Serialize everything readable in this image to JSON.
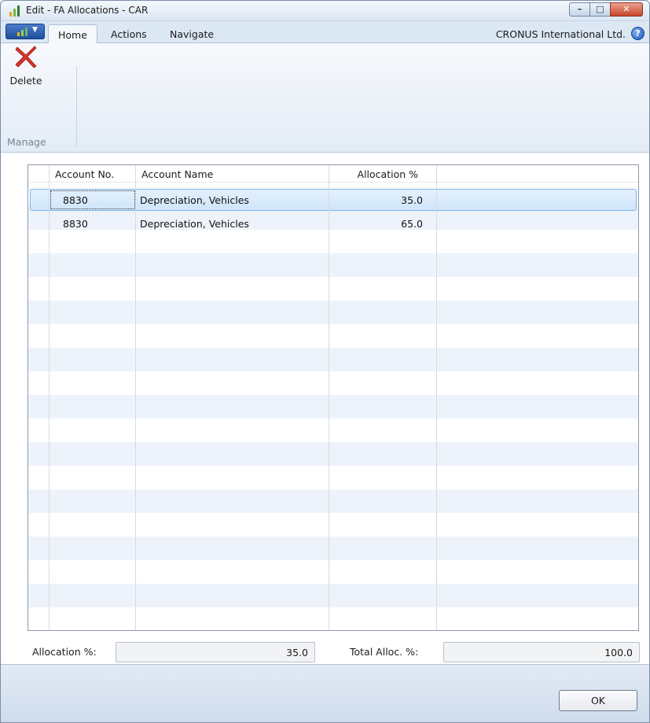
{
  "window": {
    "title": "Edit - FA Allocations - CAR",
    "app_icon": "dynamics-nav-icon",
    "controls": [
      "minimize",
      "maximize",
      "close"
    ]
  },
  "ribbon": {
    "tabs": [
      {
        "label": "Home",
        "active": true
      },
      {
        "label": "Actions",
        "active": false
      },
      {
        "label": "Navigate",
        "active": false
      }
    ],
    "company": "CRONUS International Ltd.",
    "help_icon": "help-icon",
    "groups": [
      {
        "label": "Manage",
        "buttons": [
          {
            "label": "Delete",
            "icon": "delete-x-icon"
          }
        ]
      }
    ]
  },
  "grid": {
    "columns": [
      "Account No.",
      "Account Name",
      "Allocation %"
    ],
    "rows": [
      {
        "account_no": "8830",
        "account_name": "Depreciation, Vehicles",
        "allocation_pct": "35.0",
        "selected": true
      },
      {
        "account_no": "8830",
        "account_name": "Depreciation, Vehicles",
        "allocation_pct": "65.0",
        "selected": false
      }
    ]
  },
  "footer": {
    "allocation_label": "Allocation %:",
    "allocation_value": "35.0",
    "total_label": "Total Alloc. %:",
    "total_value": "100.0"
  },
  "buttons": {
    "ok": "OK"
  },
  "colors": {
    "selection": "#cfe5fa",
    "stripe": "#eef3fb",
    "delete_icon": "#d8352a"
  }
}
